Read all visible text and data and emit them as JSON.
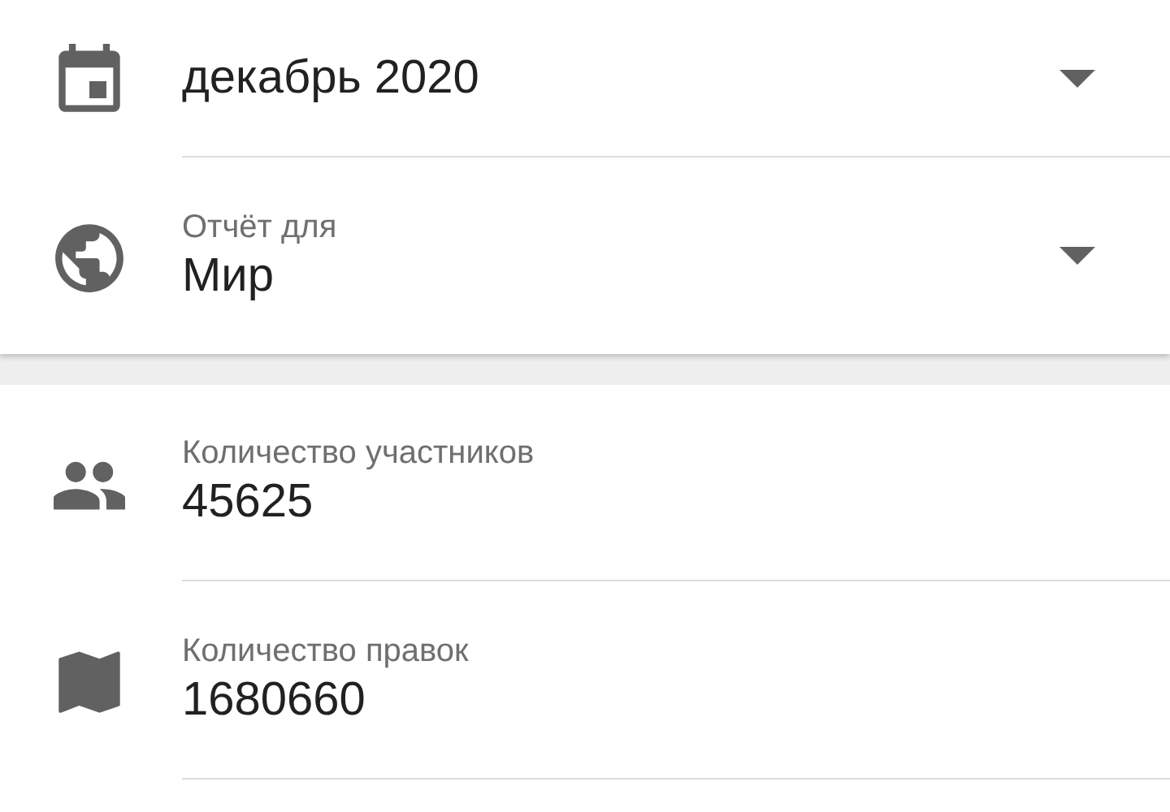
{
  "filters": [
    {
      "kind": "month",
      "value": "декабрь 2020"
    },
    {
      "kind": "region",
      "label": "Отчёт для",
      "value": "Мир"
    }
  ],
  "stats": [
    {
      "kind": "people",
      "label": "Количество участников",
      "value": "45625"
    },
    {
      "kind": "map",
      "label": "Количество правок",
      "value": "1680660"
    }
  ]
}
